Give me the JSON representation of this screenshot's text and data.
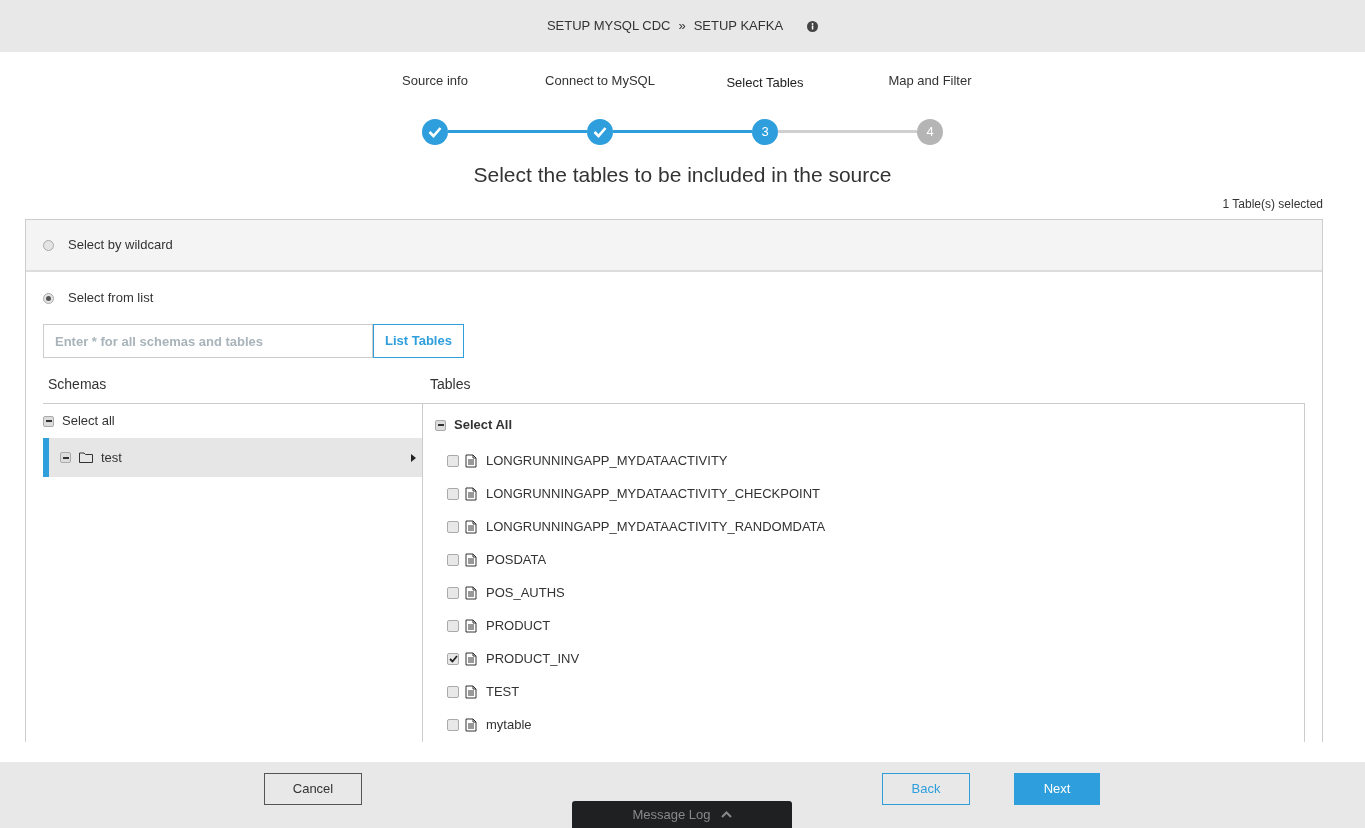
{
  "header": {
    "breadcrumb": [
      "SETUP MYSQL CDC",
      "SETUP KAFKA"
    ],
    "separator": "»"
  },
  "steps": [
    {
      "label": "Source info",
      "completed": true,
      "selected": false
    },
    {
      "label": "Connect to MySQL",
      "completed": true,
      "selected": false
    },
    {
      "label": "Select Tables",
      "number": "3",
      "completed": false,
      "selected": true
    },
    {
      "label": "Map and Filter",
      "number": "4",
      "completed": false,
      "selected": false
    }
  ],
  "title": "Select the tables to be included in the source",
  "selection_count": "1 Table(s) selected",
  "options": [
    {
      "label": "Select by wildcard",
      "selected": false
    },
    {
      "label": "Select from list",
      "selected": true
    }
  ],
  "search": {
    "placeholder": "Enter * for all schemas and tables",
    "button": "List Tables"
  },
  "schemas": {
    "heading": "Schemas",
    "select_all": "Select all",
    "select_all_indeterminate": true,
    "items": [
      {
        "name": "test",
        "selected": true,
        "indeterminate": true
      }
    ]
  },
  "tables": {
    "heading": "Tables",
    "select_all": "Select All",
    "select_all_indeterminate": true,
    "items": [
      {
        "name": "LONGRUNNINGAPP_MYDATAACTIVITY",
        "checked": false
      },
      {
        "name": "LONGRUNNINGAPP_MYDATAACTIVITY_CHECKPOINT",
        "checked": false
      },
      {
        "name": "LONGRUNNINGAPP_MYDATAACTIVITY_RANDOMDATA",
        "checked": false
      },
      {
        "name": "POSDATA",
        "checked": false
      },
      {
        "name": "POS_AUTHS",
        "checked": false
      },
      {
        "name": "PRODUCT",
        "checked": false
      },
      {
        "name": "PRODUCT_INV",
        "checked": true
      },
      {
        "name": "TEST",
        "checked": false
      },
      {
        "name": "mytable",
        "checked": false
      }
    ]
  },
  "footer": {
    "cancel": "Cancel",
    "back": "Back",
    "next": "Next",
    "message_log": "Message Log"
  }
}
